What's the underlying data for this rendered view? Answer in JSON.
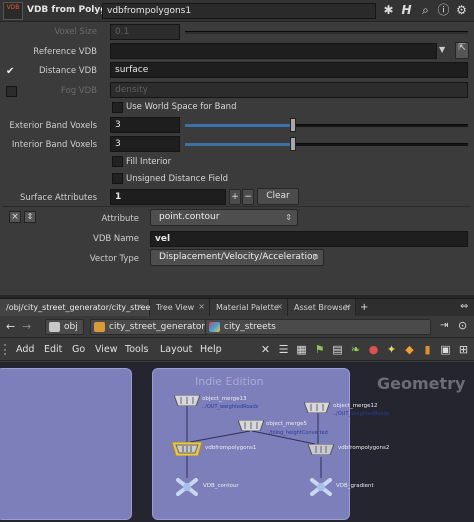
{
  "params": {
    "header": {
      "node_type": "VDB from Polygons",
      "node_name": "vdbfrompolygons1",
      "badge_text": "VDB",
      "help_label": "H"
    },
    "voxel_size": {
      "label": "Voxel Size",
      "value": "0.1"
    },
    "reference_vdb": {
      "label": "Reference VDB",
      "value": ""
    },
    "distance_vdb": {
      "label": "Distance VDB",
      "value": "surface",
      "checked": "✔"
    },
    "fog_vdb": {
      "label": "Fog VDB",
      "value": "density"
    },
    "world_space": {
      "label": "Use World Space for Band"
    },
    "exterior_band": {
      "label": "Exterior Band Voxels",
      "value": "3",
      "fraction": 0.38
    },
    "interior_band": {
      "label": "Interior Band Voxels",
      "value": "3",
      "fraction": 0.38
    },
    "fill_interior": {
      "label": "Fill Interior"
    },
    "unsigned_distance": {
      "label": "Unsigned Distance Field"
    },
    "surface_attributes": {
      "label": "Surface Attributes",
      "value": "1",
      "plus": "+",
      "minus": "−",
      "clear": "Clear"
    },
    "multiparm_icons": {
      "remove": "×",
      "move": "⇕"
    },
    "attribute": {
      "label": "Attribute",
      "value": "point.contour"
    },
    "vdb_name": {
      "label": "VDB Name",
      "value": "vel"
    },
    "vector_type": {
      "label": "Vector Type",
      "value": "Displacement/Velocity/Acceleration"
    }
  },
  "tabs": [
    {
      "label": "/obj/city_street_generator/city_streets"
    },
    {
      "label": "Tree View"
    },
    {
      "label": "Material Palette"
    },
    {
      "label": "Asset Browser"
    }
  ],
  "path": {
    "back": "←",
    "forward": "→",
    "crumbs": [
      "obj",
      "city_street_generator",
      "city_streets"
    ]
  },
  "menu": [
    "Add",
    "Edit",
    "Go",
    "View",
    "Tools",
    "Layout",
    "Help"
  ],
  "network": {
    "watermark": "Indie Edition",
    "context_label": "Geometry",
    "nodes": [
      {
        "name": "object_merge13",
        "sub": "../OUT_weightedRoads"
      },
      {
        "name": "object_merge12",
        "sub": "../OUT_weightedRoads"
      },
      {
        "name": "object_merge5",
        "sub": "../tiling_heightConverted"
      },
      {
        "name": "vdbfrompolygons1",
        "sub": ""
      },
      {
        "name": "vdbfrompolygons2",
        "sub": ""
      },
      {
        "name": "VDB_contour",
        "sub": ""
      },
      {
        "name": "VDB_gradient",
        "sub": ""
      }
    ]
  },
  "colors": {
    "accent_blue": "#3d6fa8",
    "network_box": "#7d7fbb",
    "selected_node": "#e8c84a"
  }
}
